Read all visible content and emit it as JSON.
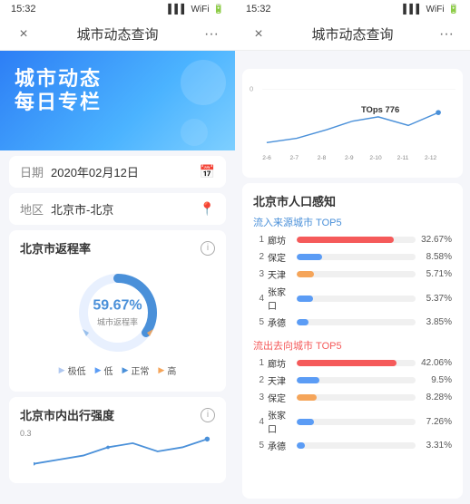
{
  "left": {
    "statusBar": {
      "time": "15:32",
      "icons": "📶 🔋"
    },
    "header": {
      "title": "城市动态查询",
      "back": "×",
      "more": "···"
    },
    "hero": {
      "line1": "城市动态",
      "line2": "每日专栏"
    },
    "dateField": {
      "label": "日期",
      "value": "2020年02月12日",
      "icon": "📅"
    },
    "areaField": {
      "label": "地区",
      "value": "北京市-北京",
      "icon": "📍"
    },
    "returnRate": {
      "title": "北京市返程率",
      "infoIcon": "i",
      "percentage": "59.67%",
      "subLabel": "城市返程率",
      "legend": [
        "极低",
        "低",
        "正常",
        "高"
      ]
    },
    "innerMovement": {
      "title": "北京市内出行强度",
      "infoIcon": "i",
      "yLabel": "0.3"
    }
  },
  "right": {
    "statusBar": {
      "time": "15:32",
      "icons": "📶 🔋"
    },
    "header": {
      "title": "城市动态查询",
      "back": "×",
      "more": "···"
    },
    "chart": {
      "yStart": "0",
      "labels": [
        "2-6",
        "2-7",
        "2-8",
        "2-9",
        "2-10",
        "2-11",
        "2-12"
      ]
    },
    "population": {
      "title": "北京市人口感知",
      "inflow": {
        "sectionLabel": "流入来源城市 TOP5",
        "items": [
          {
            "rank": "1",
            "city": "廊坊",
            "pct": 32.67,
            "pctLabel": "32.67%",
            "color": "red"
          },
          {
            "rank": "2",
            "city": "保定",
            "pct": 8.58,
            "pctLabel": "8.58%",
            "color": "blue"
          },
          {
            "rank": "3",
            "city": "天津",
            "pct": 5.71,
            "pctLabel": "5.71%",
            "color": "orange"
          },
          {
            "rank": "4",
            "city": "张家口",
            "pct": 5.37,
            "pctLabel": "5.37%",
            "color": "blue"
          },
          {
            "rank": "5",
            "city": "承德",
            "pct": 3.85,
            "pctLabel": "3.85%",
            "color": "blue"
          }
        ]
      },
      "outflow": {
        "sectionLabel": "流出去向城市 TOP5",
        "items": [
          {
            "rank": "1",
            "city": "廊坊",
            "pct": 42.06,
            "pctLabel": "42.06%",
            "color": "red"
          },
          {
            "rank": "2",
            "city": "天津",
            "pct": 9.5,
            "pctLabel": "9.5%",
            "color": "blue"
          },
          {
            "rank": "3",
            "city": "保定",
            "pct": 8.28,
            "pctLabel": "8.28%",
            "color": "orange"
          },
          {
            "rank": "4",
            "city": "张家口",
            "pct": 7.26,
            "pctLabel": "7.26%",
            "color": "blue"
          },
          {
            "rank": "5",
            "city": "承德",
            "pct": 3.31,
            "pctLabel": "3.31%",
            "color": "blue"
          }
        ]
      }
    }
  }
}
